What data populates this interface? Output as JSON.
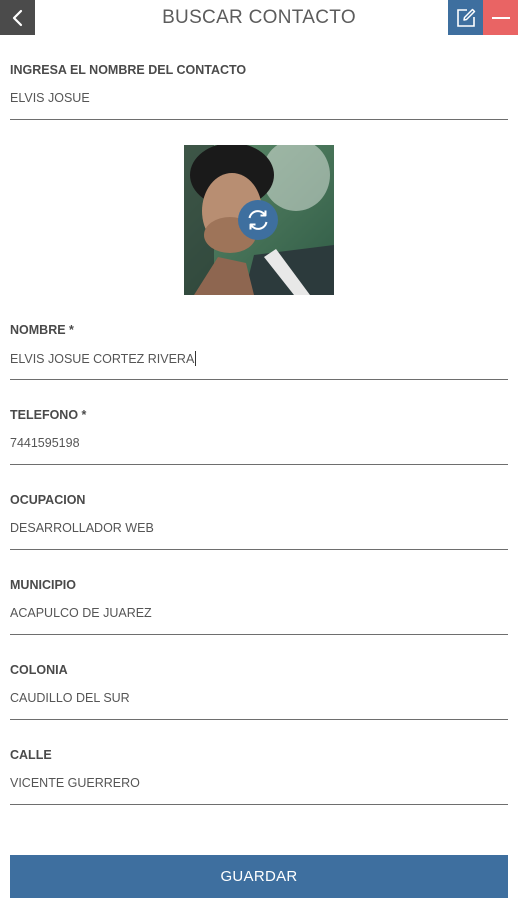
{
  "header": {
    "title": "BUSCAR CONTACTO",
    "back_icon": "chevron-left-icon",
    "edit_icon": "edit-icon",
    "minimize_icon": "minus-icon"
  },
  "colors": {
    "primary": "#3e6f9f",
    "danger": "#e96464",
    "back_bg": "#4b4b4b"
  },
  "search": {
    "label": "INGRESA EL NOMBRE DEL CONTACTO",
    "value": "ELVIS JOSUE"
  },
  "photo": {
    "rotate_icon": "refresh-icon"
  },
  "form": {
    "nombre": {
      "label": "NOMBRE *",
      "value": "ELVIS JOSUE CORTEZ RIVERA"
    },
    "telefono": {
      "label": "TELEFONO *",
      "value": "7441595198"
    },
    "ocupacion": {
      "label": "OCUPACION",
      "value": "DESARROLLADOR WEB"
    },
    "municipio": {
      "label": "MUNICIPIO",
      "value": "ACAPULCO DE JUAREZ"
    },
    "colonia": {
      "label": "COLONIA",
      "value": "CAUDILLO DEL SUR"
    },
    "calle": {
      "label": "CALLE",
      "value": "VICENTE GUERRERO"
    }
  },
  "actions": {
    "save_label": "GUARDAR"
  }
}
